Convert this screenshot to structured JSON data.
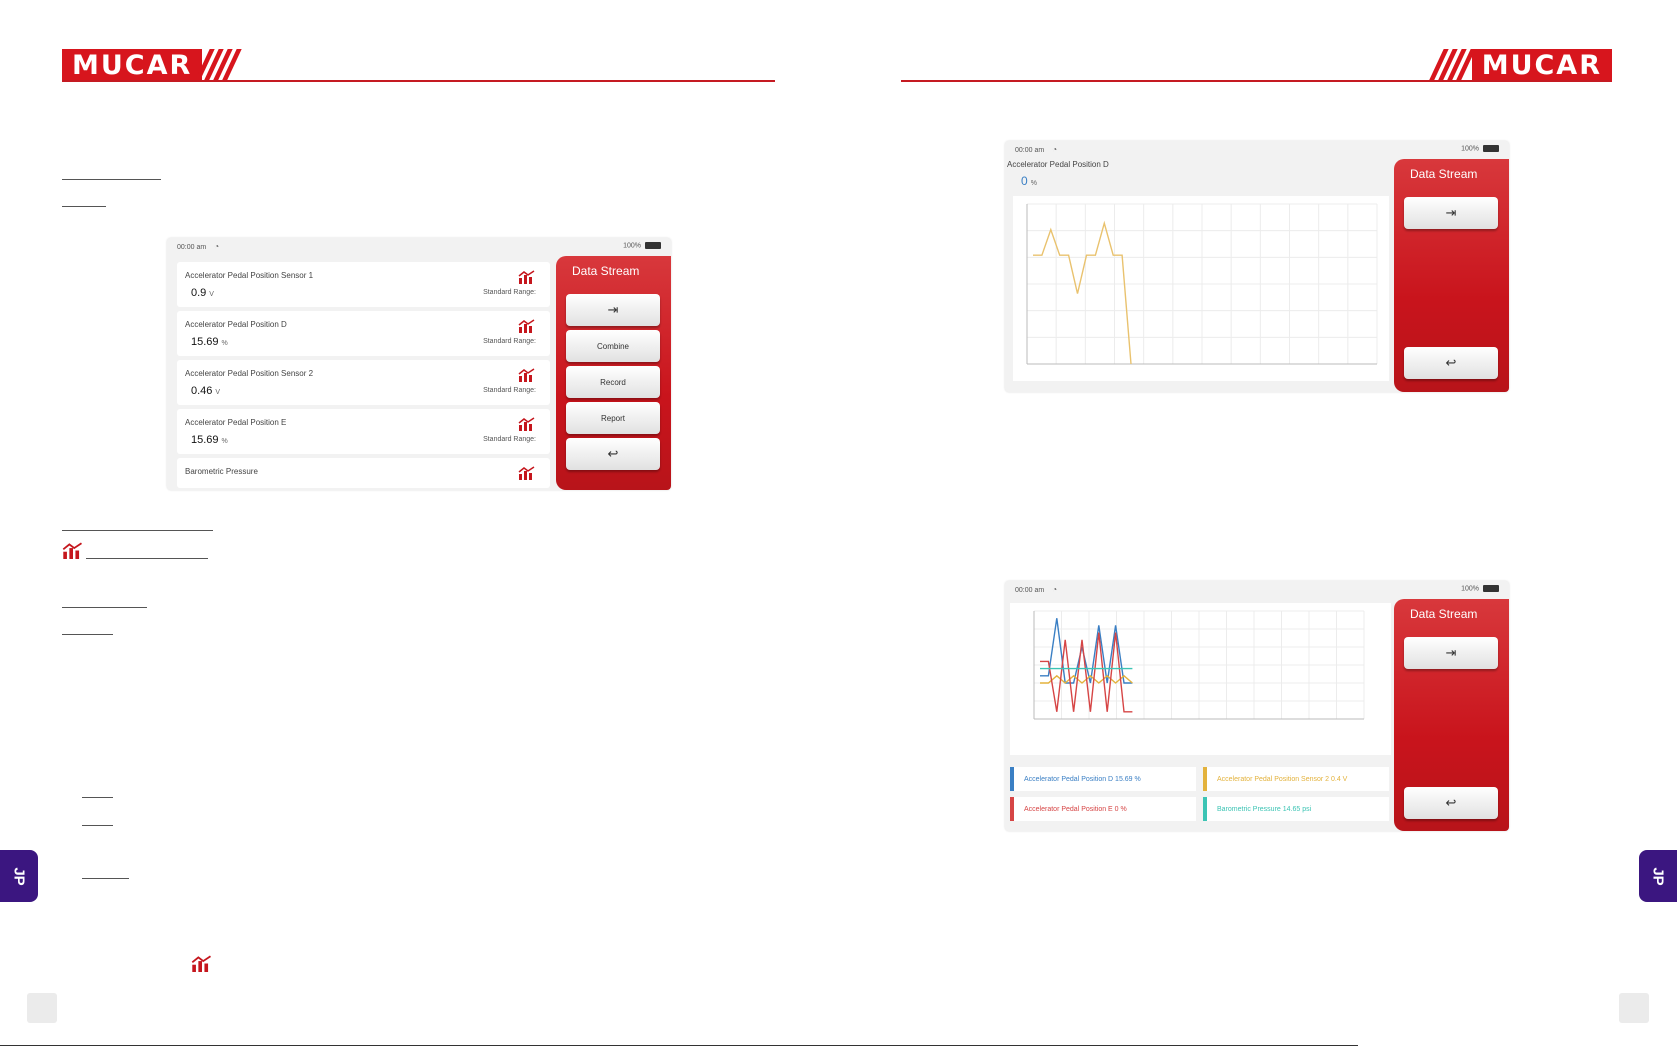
{
  "brand": {
    "name": "MUCAR"
  },
  "jp_tab": "JP",
  "screen1": {
    "status_time": "00:00 am",
    "status_battery": "100%",
    "panel_title": "Data Stream",
    "buttons": [
      "Combine",
      "Record",
      "Report"
    ],
    "rows": [
      {
        "name": "Accelerator Pedal Position Sensor 1",
        "value": "0.9",
        "unit": "V",
        "range": "Standard Range:"
      },
      {
        "name": "Accelerator Pedal Position D",
        "value": "15.69",
        "unit": "%",
        "range": "Standard Range:"
      },
      {
        "name": "Accelerator Pedal Position Sensor 2",
        "value": "0.46",
        "unit": "V",
        "range": "Standard Range:"
      },
      {
        "name": "Accelerator Pedal Position E",
        "value": "15.69",
        "unit": "%",
        "range": "Standard Range:"
      },
      {
        "name": "Barometric Pressure",
        "value": "",
        "unit": "",
        "range": ""
      }
    ]
  },
  "screen2": {
    "status_time": "00:00 am",
    "status_battery": "100%",
    "panel_title": "Data Stream",
    "chart_title": "Accelerator Pedal Position D",
    "chart_value": "0",
    "chart_unit": "%"
  },
  "screen3": {
    "status_time": "00:00 am",
    "status_battery": "100%",
    "panel_title": "Data Stream",
    "legend": [
      {
        "label": "Accelerator Pedal Position D 15.69 %",
        "color": "#3a7fc4"
      },
      {
        "label": "Accelerator Pedal Position Sensor 2 0.4 V",
        "color": "#e3b23c"
      },
      {
        "label": "Accelerator Pedal Position E 0 %",
        "color": "#d64545"
      },
      {
        "label": "Barometric Pressure 14.65 psi",
        "color": "#3cc4b4"
      }
    ]
  },
  "colors": {
    "brand_red": "#d7151d",
    "tab_purple": "#3b1680"
  },
  "chart_data": [
    {
      "type": "line",
      "title": "Accelerator Pedal Position D",
      "series": [
        {
          "values": [
            17,
            17,
            21,
            17,
            17,
            11,
            17,
            17,
            22,
            17,
            17,
            0
          ]
        }
      ],
      "ylim": [
        0,
        25
      ],
      "grid": true
    },
    {
      "type": "line",
      "series": [
        {
          "name": "Accelerator Pedal Position D",
          "values": [
            12,
            12,
            28,
            10,
            10,
            20,
            10,
            26,
            10,
            26,
            10,
            10
          ]
        },
        {
          "name": "Accelerator Pedal Position Sensor 2",
          "values": [
            10,
            10,
            12,
            10,
            12,
            10,
            12,
            10,
            12,
            10,
            12,
            10
          ]
        },
        {
          "name": "Accelerator Pedal Position E",
          "values": [
            16,
            16,
            2,
            22,
            2,
            22,
            2,
            24,
            2,
            24,
            2,
            2
          ]
        },
        {
          "name": "Barometric Pressure",
          "values": [
            14,
            14,
            14,
            14,
            14,
            14,
            14,
            14,
            14,
            14,
            14,
            14
          ]
        }
      ],
      "ylim": [
        0,
        30
      ],
      "grid": true
    }
  ]
}
